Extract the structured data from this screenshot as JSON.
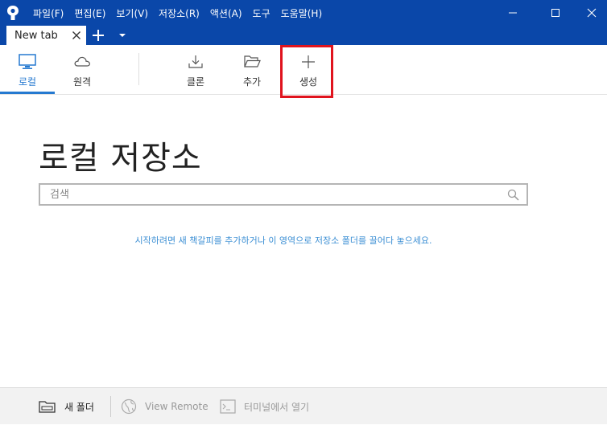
{
  "menu": [
    "파일(F)",
    "편집(E)",
    "보기(V)",
    "저장소(R)",
    "액션(A)",
    "도구",
    "도움말(H)"
  ],
  "tabs": [
    {
      "label": "New tab"
    }
  ],
  "toolbar": {
    "local": "로컬",
    "remote": "원격",
    "clone": "클론",
    "add": "추가",
    "create": "생성"
  },
  "main": {
    "title": "로컬 저장소",
    "search_placeholder": "검색",
    "hint": "시작하려면 새 책갈피를 추가하거나 이 영역으로 저장소 폴더를 끌어다 놓으세요."
  },
  "footer": {
    "new_folder": "새 폴더",
    "view_remote": "View Remote",
    "open_terminal": "터미널에서 열기"
  },
  "colors": {
    "titlebar": "#0a47a9",
    "accent": "#2579d0",
    "highlight": "#e0141e",
    "hint_text": "#3c8fd4"
  }
}
